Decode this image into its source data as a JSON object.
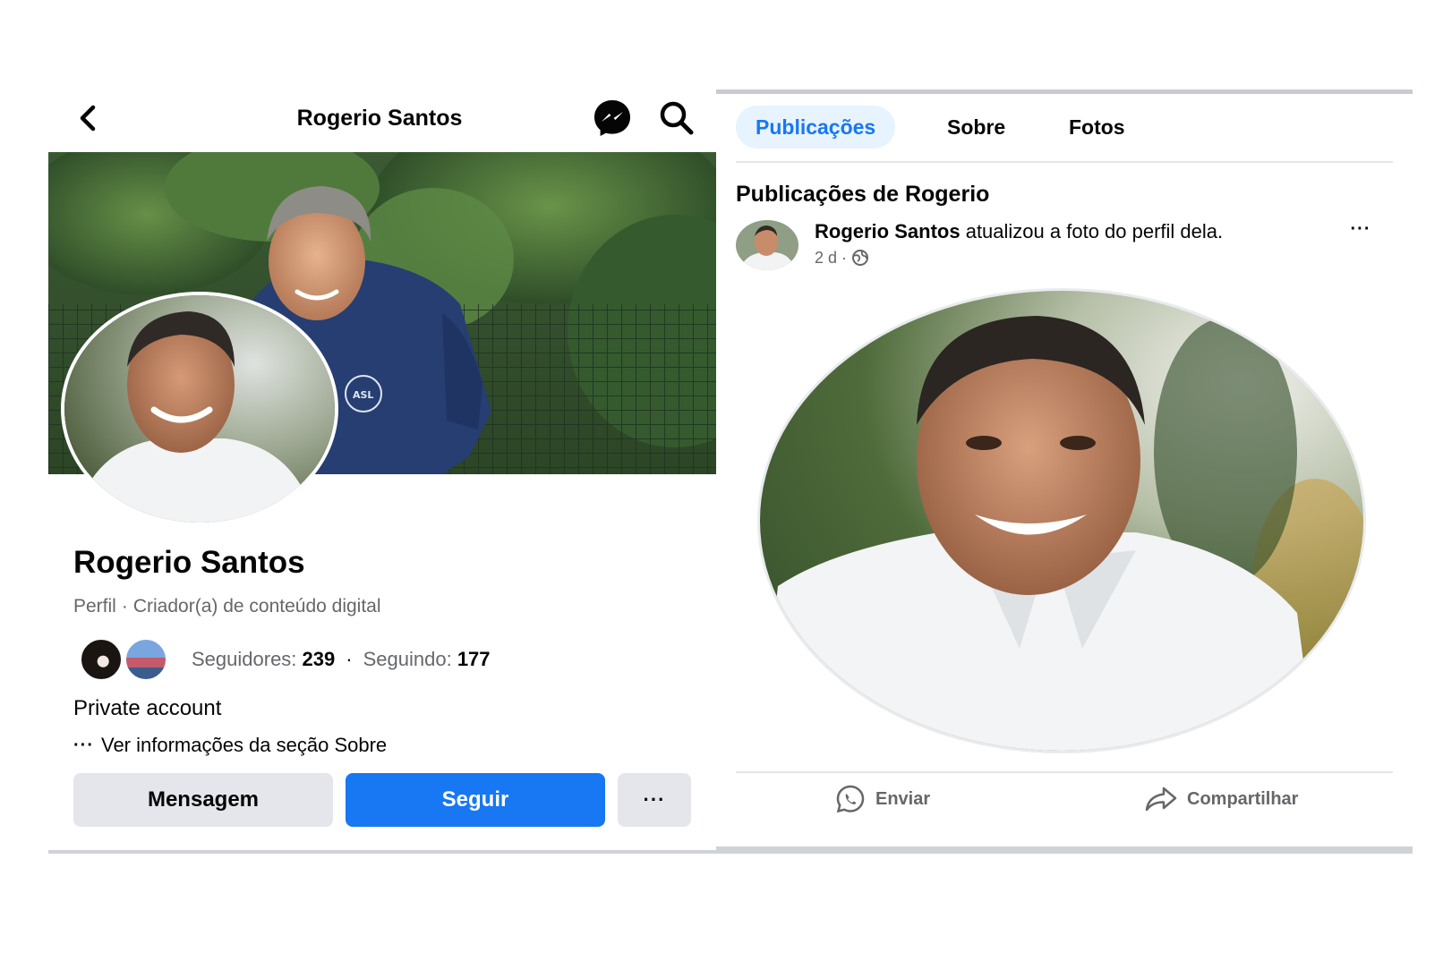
{
  "profile_header": {
    "title": "Rogerio Santos"
  },
  "profile": {
    "name": "Rogerio Santos",
    "category_prefix": "Perfil",
    "category_sep": "·",
    "category": "Criador(a) de conteúdo digital",
    "followers_label": "Seguidores:",
    "followers_count": "239",
    "stats_sep": "·",
    "following_label": "Seguindo:",
    "following_count": "177",
    "privacy": "Private account",
    "about_dots": "···",
    "about_link": "Ver informações da seção Sobre"
  },
  "actions": {
    "message": "Mensagem",
    "follow": "Seguir",
    "more": "···"
  },
  "tabs": [
    {
      "label": "Publicações",
      "active": true
    },
    {
      "label": "Sobre",
      "active": false
    },
    {
      "label": "Fotos",
      "active": false
    }
  ],
  "posts": {
    "section_title": "Publicações de Rogerio",
    "item": {
      "author": "Rogerio Santos",
      "action": "atualizou a foto do perfil dela.",
      "time": "2 d",
      "time_sep": "·",
      "more": "···"
    },
    "send": "Enviar",
    "share": "Compartilhar"
  },
  "colors": {
    "accent": "#1877f2",
    "secondary_button": "#e4e6eb",
    "muted_text": "#65676b",
    "active_tab_bg": "#e7f3ff"
  }
}
